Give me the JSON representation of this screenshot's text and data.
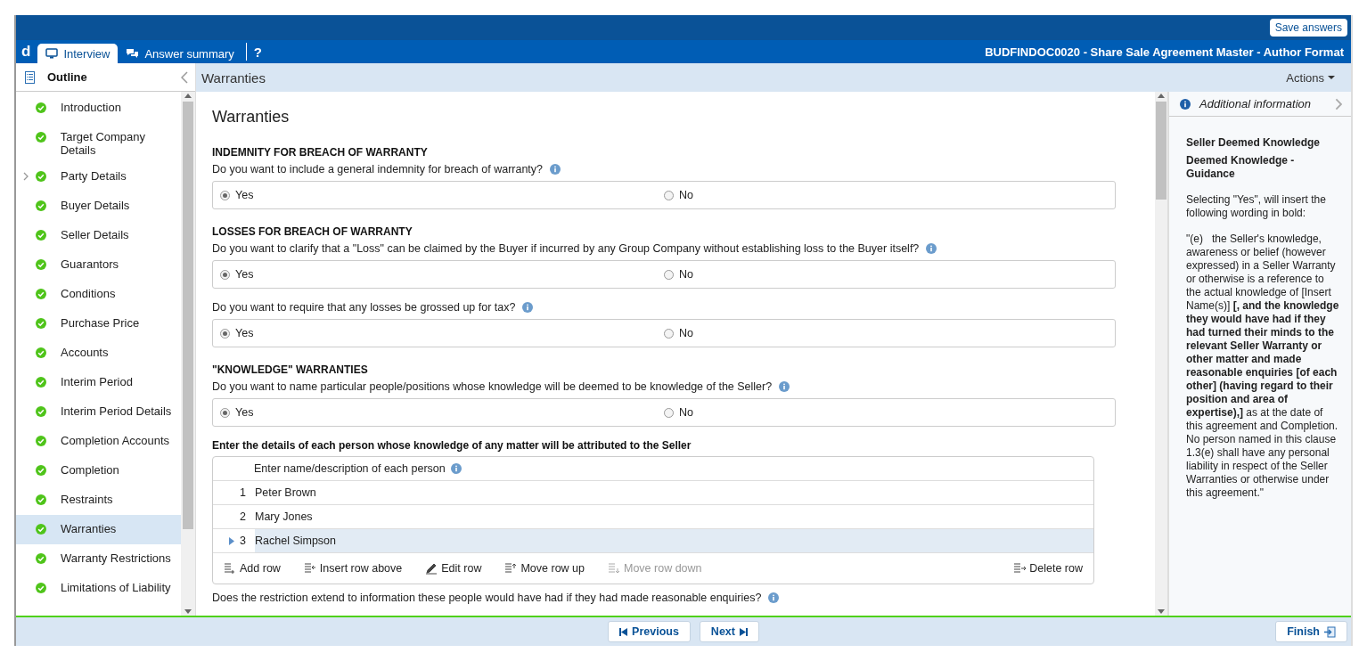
{
  "header": {
    "save_button": "Save answers",
    "logo": "d",
    "tabs": [
      {
        "label": "Interview",
        "selected": true
      },
      {
        "label": "Answer summary",
        "selected": false
      }
    ],
    "help": "?",
    "document_title": "BUDFINDOC0020 - Share Sale Agreement Master - Author Format"
  },
  "outline": {
    "title": "Outline",
    "items": [
      {
        "label": "Introduction",
        "complete": true,
        "selected": false,
        "expandable": false
      },
      {
        "label": "Target Company Details",
        "complete": true,
        "selected": false,
        "expandable": false
      },
      {
        "label": "Party Details",
        "complete": true,
        "selected": false,
        "expandable": true
      },
      {
        "label": "Buyer Details",
        "complete": true,
        "selected": false,
        "expandable": false
      },
      {
        "label": "Seller Details",
        "complete": true,
        "selected": false,
        "expandable": false
      },
      {
        "label": "Guarantors",
        "complete": true,
        "selected": false,
        "expandable": false
      },
      {
        "label": "Conditions",
        "complete": true,
        "selected": false,
        "expandable": false
      },
      {
        "label": "Purchase Price",
        "complete": true,
        "selected": false,
        "expandable": false
      },
      {
        "label": "Accounts",
        "complete": true,
        "selected": false,
        "expandable": false
      },
      {
        "label": "Interim Period",
        "complete": true,
        "selected": false,
        "expandable": false
      },
      {
        "label": "Interim Period Details",
        "complete": true,
        "selected": false,
        "expandable": false
      },
      {
        "label": "Completion Accounts",
        "complete": true,
        "selected": false,
        "expandable": false
      },
      {
        "label": "Completion",
        "complete": true,
        "selected": false,
        "expandable": false
      },
      {
        "label": "Restraints",
        "complete": true,
        "selected": false,
        "expandable": false
      },
      {
        "label": "Warranties",
        "complete": true,
        "selected": true,
        "expandable": false
      },
      {
        "label": "Warranty Restrictions",
        "complete": true,
        "selected": false,
        "expandable": false
      },
      {
        "label": "Limitations of Liability",
        "complete": true,
        "selected": false,
        "expandable": false
      }
    ]
  },
  "page": {
    "section_title": "Warranties",
    "actions": "Actions",
    "heading": "Warranties",
    "items": [
      {
        "kind": "heading",
        "text": "INDEMNITY FOR BREACH OF WARRANTY"
      },
      {
        "kind": "question",
        "text": "Do you want to include a general indemnity for breach of warranty?",
        "options": [
          {
            "label": "Yes",
            "selected": true
          },
          {
            "label": "No",
            "selected": false
          }
        ]
      },
      {
        "kind": "heading",
        "text": "LOSSES FOR BREACH OF WARRANTY"
      },
      {
        "kind": "question",
        "text": "Do you want to clarify that a \"Loss\" can be claimed by the Buyer if incurred by any Group Company without establishing loss to the Buyer itself?",
        "options": [
          {
            "label": "Yes",
            "selected": true
          },
          {
            "label": "No",
            "selected": false
          }
        ]
      },
      {
        "kind": "question",
        "text": "Do you want to require that any losses be grossed up for tax?",
        "options": [
          {
            "label": "Yes",
            "selected": true
          },
          {
            "label": "No",
            "selected": false
          }
        ]
      },
      {
        "kind": "heading",
        "text": "\"KNOWLEDGE\" WARRANTIES"
      },
      {
        "kind": "question",
        "text": "Do you want to name particular people/positions whose knowledge will be deemed to be knowledge of the Seller?",
        "options": [
          {
            "label": "Yes",
            "selected": true
          },
          {
            "label": "No",
            "selected": false
          }
        ]
      },
      {
        "kind": "table",
        "text": "Enter the details of each person whose knowledge of any matter will be attributed to the Seller",
        "column": "Enter name/description of each person",
        "rows": [
          {
            "number": "1",
            "value": "Peter Brown",
            "selected": false
          },
          {
            "number": "2",
            "value": "Mary Jones",
            "selected": false
          },
          {
            "number": "3",
            "value": "Rachel Simpson",
            "selected": true
          }
        ],
        "toolbar": [
          {
            "label": "Add row",
            "kind": "add",
            "disabled": false
          },
          {
            "label": "Insert row above",
            "kind": "insert",
            "disabled": false
          },
          {
            "label": "Edit row",
            "kind": "edit",
            "disabled": false
          },
          {
            "label": "Move row up",
            "kind": "up",
            "disabled": false
          },
          {
            "label": "Move row down",
            "kind": "down",
            "disabled": true
          },
          {
            "label": "Delete row",
            "kind": "delete",
            "disabled": false
          }
        ]
      },
      {
        "kind": "prompt",
        "text": "Does the restriction extend to information these people would have had if they had made reasonable enquiries?"
      }
    ]
  },
  "info_panel": {
    "title": "Additional information",
    "heading": "Seller Deemed Knowledge",
    "subheading": "Deemed Knowledge - Guidance",
    "paragraphs": [
      "Selecting \"Yes\", will insert the following wording in bold:",
      "\"(e)   the Seller's knowledge, awareness or belief (however expressed) in a Seller Warranty or otherwise is a reference to the actual knowledge of [Insert Name(s)] **[, and the knowledge they would have had if they had turned their minds to the relevant Seller Warranty or other matter and made reasonable enquiries [of each other] (having regard to their position and area of expertise),]** as at the date of this agreement and Completion. No person named in this clause 1.3(e) shall have any personal liability in respect of the Seller Warranties or otherwise under this agreement.\""
    ]
  },
  "footer": {
    "previous": "Previous",
    "next": "Next",
    "finish": "Finish"
  }
}
